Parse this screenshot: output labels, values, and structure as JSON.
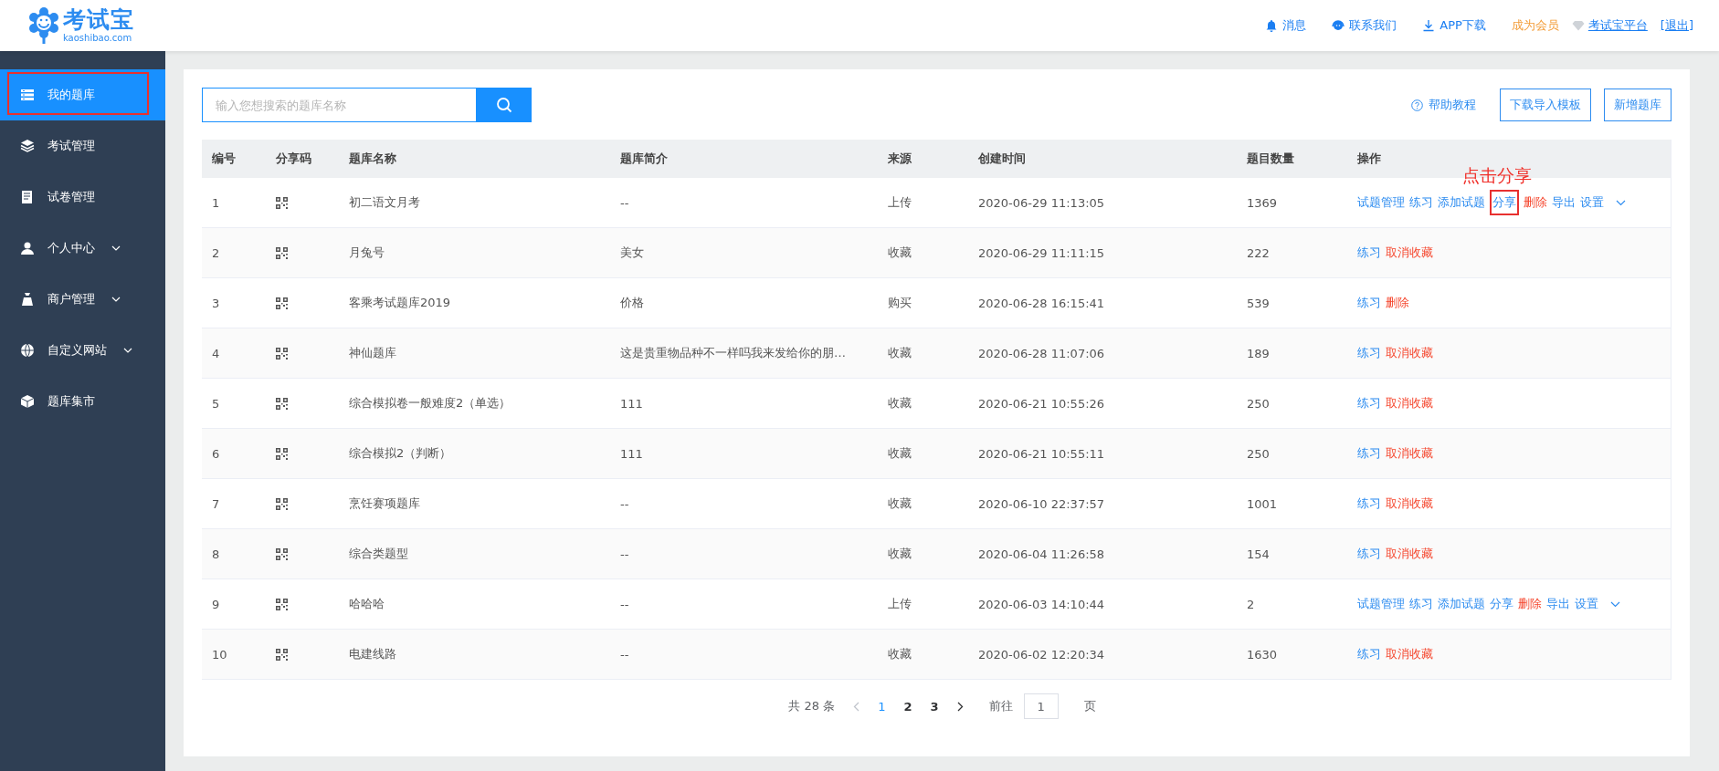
{
  "header": {
    "logo": {
      "name": "考试宝",
      "domain": "kaoshibao.com"
    },
    "nav": [
      {
        "label": "消息",
        "kind": "bell"
      },
      {
        "label": "联系我们",
        "kind": "headset"
      },
      {
        "label": "APP下载",
        "kind": "download"
      },
      {
        "label": "成为会员",
        "kind": "vip"
      },
      {
        "label": "考试宝平台",
        "kind": "diamond"
      },
      {
        "label": "[退出]",
        "kind": "logout"
      }
    ]
  },
  "sidebar": {
    "items": [
      {
        "label": "我的题库",
        "selected": true,
        "highlighted": true,
        "expandable": false
      },
      {
        "label": "考试管理",
        "selected": false,
        "highlighted": false,
        "expandable": false
      },
      {
        "label": "试卷管理",
        "selected": false,
        "highlighted": false,
        "expandable": false
      },
      {
        "label": "个人中心",
        "selected": false,
        "highlighted": false,
        "expandable": true
      },
      {
        "label": "商户管理",
        "selected": false,
        "highlighted": false,
        "expandable": true
      },
      {
        "label": "自定义网站",
        "selected": false,
        "highlighted": false,
        "expandable": true
      },
      {
        "label": "题库集市",
        "selected": false,
        "highlighted": false,
        "expandable": false
      }
    ]
  },
  "toolbar": {
    "search": {
      "placeholder": "输入您想搜索的题库名称"
    },
    "help_link": "帮助教程",
    "buttons": [
      "下载导入模板",
      "新增题库"
    ]
  },
  "table": {
    "columns": [
      "编号",
      "分享码",
      "题库名称",
      "题库简介",
      "来源",
      "创建时间",
      "题目数量",
      "操作"
    ],
    "rows": [
      {
        "cells": [
          "1",
          "",
          "初二语文月考",
          "--",
          "上传",
          "2020-06-29 11:13:05",
          "1369"
        ],
        "actions": [
          {
            "label": "试题管理",
            "kind": "link"
          },
          {
            "label": "练习",
            "kind": "link"
          },
          {
            "label": "添加试题",
            "kind": "link"
          },
          {
            "label": "分享",
            "kind": "link",
            "callout": "点击分享"
          },
          {
            "label": "删除",
            "kind": "danger"
          },
          {
            "label": "导出",
            "kind": "link"
          },
          {
            "label": "设置",
            "kind": "link"
          }
        ],
        "more": true
      },
      {
        "cells": [
          "2",
          "",
          "月兔号",
          "美女",
          "收藏",
          "2020-06-29 11:11:15",
          "222"
        ],
        "actions": [
          {
            "label": "练习",
            "kind": "link"
          },
          {
            "label": "取消收藏",
            "kind": "danger"
          }
        ],
        "more": false
      },
      {
        "cells": [
          "3",
          "",
          "客乘考试题库2019",
          "价格",
          "购买",
          "2020-06-28 16:15:41",
          "539"
        ],
        "actions": [
          {
            "label": "练习",
            "kind": "link"
          },
          {
            "label": "删除",
            "kind": "danger"
          }
        ],
        "more": false
      },
      {
        "cells": [
          "4",
          "",
          "神仙题库",
          "这是贵重物品种不一样吗我来发给你的朋…",
          "收藏",
          "2020-06-28 11:07:06",
          "189"
        ],
        "actions": [
          {
            "label": "练习",
            "kind": "link"
          },
          {
            "label": "取消收藏",
            "kind": "danger"
          }
        ],
        "more": false
      },
      {
        "cells": [
          "5",
          "",
          "综合模拟卷一般难度2（单选）",
          "111",
          "收藏",
          "2020-06-21 10:55:26",
          "250"
        ],
        "actions": [
          {
            "label": "练习",
            "kind": "link"
          },
          {
            "label": "取消收藏",
            "kind": "danger"
          }
        ],
        "more": false
      },
      {
        "cells": [
          "6",
          "",
          "综合模拟2（判断）",
          "111",
          "收藏",
          "2020-06-21 10:55:11",
          "250"
        ],
        "actions": [
          {
            "label": "练习",
            "kind": "link"
          },
          {
            "label": "取消收藏",
            "kind": "danger"
          }
        ],
        "more": false
      },
      {
        "cells": [
          "7",
          "",
          "烹饪赛项题库",
          "--",
          "收藏",
          "2020-06-10 22:37:57",
          "1001"
        ],
        "actions": [
          {
            "label": "练习",
            "kind": "link"
          },
          {
            "label": "取消收藏",
            "kind": "danger"
          }
        ],
        "more": false
      },
      {
        "cells": [
          "8",
          "",
          "综合类题型",
          "--",
          "收藏",
          "2020-06-04 11:26:58",
          "154"
        ],
        "actions": [
          {
            "label": "练习",
            "kind": "link"
          },
          {
            "label": "取消收藏",
            "kind": "danger"
          }
        ],
        "more": false
      },
      {
        "cells": [
          "9",
          "",
          "哈哈哈",
          "--",
          "上传",
          "2020-06-03 14:10:44",
          "2"
        ],
        "actions": [
          {
            "label": "试题管理",
            "kind": "link"
          },
          {
            "label": "练习",
            "kind": "link"
          },
          {
            "label": "添加试题",
            "kind": "link"
          },
          {
            "label": "分享",
            "kind": "link"
          },
          {
            "label": "删除",
            "kind": "danger"
          },
          {
            "label": "导出",
            "kind": "link"
          },
          {
            "label": "设置",
            "kind": "link"
          }
        ],
        "more": true
      },
      {
        "cells": [
          "10",
          "",
          "电建线路",
          "--",
          "收藏",
          "2020-06-02 12:20:34",
          "1630"
        ],
        "actions": [
          {
            "label": "练习",
            "kind": "link"
          },
          {
            "label": "取消收藏",
            "kind": "danger"
          }
        ],
        "more": false
      }
    ]
  },
  "pagination": {
    "total": "共 28 条",
    "pages": [
      {
        "label": "1",
        "selected": true
      },
      {
        "label": "2",
        "selected": false
      },
      {
        "label": "3",
        "selected": false
      }
    ],
    "goto_label": "前往",
    "goto_value": "1",
    "page_unit": "页"
  }
}
